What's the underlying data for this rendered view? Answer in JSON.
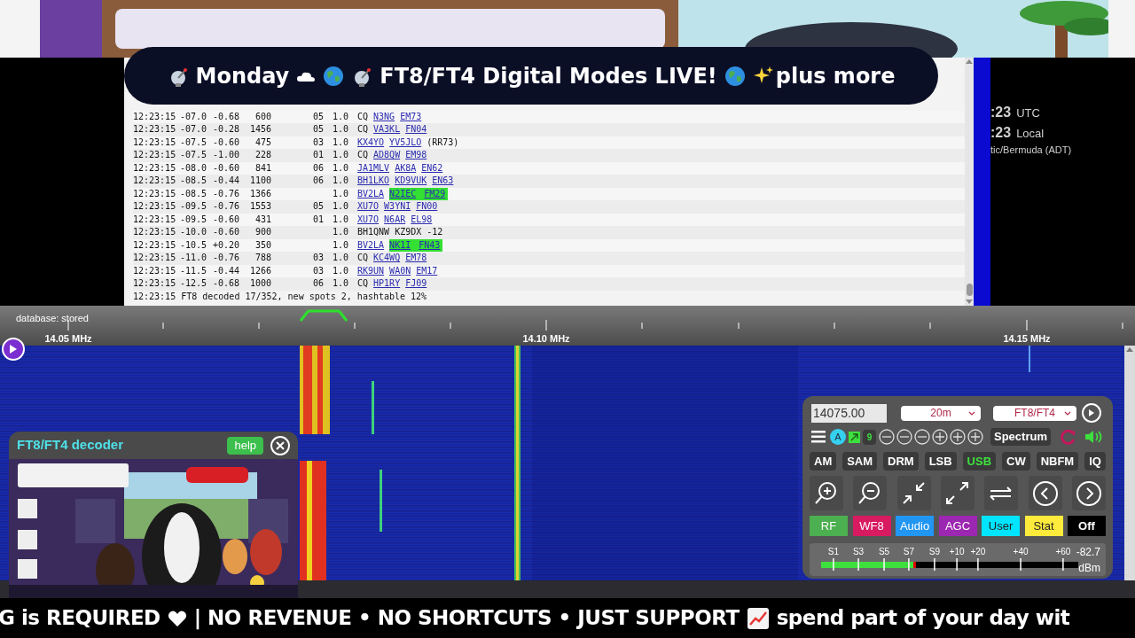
{
  "title_bar": {
    "segments": [
      "Monday",
      "FT8/FT4 Digital Modes LIVE!",
      "plus more"
    ]
  },
  "log": {
    "rows": [
      {
        "time": "12:23:15",
        "snr": "-07.0",
        "dt": "-0.68",
        "freq": "600",
        "slot": "05",
        "ver": "1.0",
        "message": [
          {
            "kind": "text",
            "text": "CQ"
          },
          {
            "kind": "link",
            "text": "N3NG"
          },
          {
            "kind": "link",
            "text": "EM73"
          }
        ]
      },
      {
        "time": "12:23:15",
        "snr": "-07.0",
        "dt": "-0.28",
        "freq": "1456",
        "slot": "05",
        "ver": "1.0",
        "message": [
          {
            "kind": "text",
            "text": "CQ"
          },
          {
            "kind": "link",
            "text": "VA3KL"
          },
          {
            "kind": "link",
            "text": "FN04"
          }
        ]
      },
      {
        "time": "12:23:15",
        "snr": "-07.5",
        "dt": "-0.60",
        "freq": "475",
        "slot": "03",
        "ver": "1.0",
        "message": [
          {
            "kind": "link",
            "text": "KX4YO"
          },
          {
            "kind": "link",
            "text": "YV5JLO"
          },
          {
            "kind": "text",
            "text": "(RR73)"
          }
        ]
      },
      {
        "time": "12:23:15",
        "snr": "-07.5",
        "dt": "-1.00",
        "freq": "228",
        "slot": "01",
        "ver": "1.0",
        "message": [
          {
            "kind": "text",
            "text": "CQ"
          },
          {
            "kind": "link",
            "text": "AD8QW"
          },
          {
            "kind": "link",
            "text": "EM98"
          }
        ]
      },
      {
        "time": "12:23:15",
        "snr": "-08.0",
        "dt": "-0.60",
        "freq": "841",
        "slot": "06",
        "ver": "1.0",
        "message": [
          {
            "kind": "link",
            "text": "JA1MLV"
          },
          {
            "kind": "link",
            "text": "AK8A"
          },
          {
            "kind": "link",
            "text": "EN62"
          }
        ]
      },
      {
        "time": "12:23:15",
        "snr": "-08.5",
        "dt": "-0.44",
        "freq": "1100",
        "slot": "06",
        "ver": "1.0",
        "message": [
          {
            "kind": "link",
            "text": "BH1LKO"
          },
          {
            "kind": "link",
            "text": "KD9VUK"
          },
          {
            "kind": "link",
            "text": "EN63"
          }
        ]
      },
      {
        "time": "12:23:15",
        "snr": "-08.5",
        "dt": "-0.76",
        "freq": "1366",
        "ver": "1.0",
        "message": [
          {
            "kind": "link",
            "text": "BV2LA"
          },
          {
            "kind": "spot",
            "text": "N2IEC"
          },
          {
            "kind": "spot",
            "text": "FM29"
          }
        ]
      },
      {
        "time": "12:23:15",
        "snr": "-09.5",
        "dt": "-0.76",
        "freq": "1553",
        "slot": "05",
        "ver": "1.0",
        "message": [
          {
            "kind": "link",
            "text": "XU7O"
          },
          {
            "kind": "link",
            "text": "W3YNI"
          },
          {
            "kind": "link",
            "text": "FN00"
          }
        ]
      },
      {
        "time": "12:23:15",
        "snr": "-09.5",
        "dt": "-0.60",
        "freq": "431",
        "slot": "01",
        "ver": "1.0",
        "message": [
          {
            "kind": "link",
            "text": "XU7O"
          },
          {
            "kind": "link",
            "text": "N6AR"
          },
          {
            "kind": "link",
            "text": "EL98"
          }
        ]
      },
      {
        "time": "12:23:15",
        "snr": "-10.0",
        "dt": "-0.60",
        "freq": "900",
        "ver": "1.0",
        "message": [
          {
            "kind": "text",
            "text": "BH1QNW"
          },
          {
            "kind": "text",
            "text": "KZ9DX"
          },
          {
            "kind": "text",
            "text": "-12"
          }
        ]
      },
      {
        "time": "12:23:15",
        "snr": "-10.5",
        "dt": "+0.20",
        "freq": "350",
        "ver": "1.0",
        "message": [
          {
            "kind": "link",
            "text": "BV2LA"
          },
          {
            "kind": "spot",
            "text": "NK1I"
          },
          {
            "kind": "spot",
            "text": "FN43"
          }
        ]
      },
      {
        "time": "12:23:15",
        "snr": "-11.0",
        "dt": "-0.76",
        "freq": "788",
        "slot": "03",
        "ver": "1.0",
        "message": [
          {
            "kind": "text",
            "text": "CQ"
          },
          {
            "kind": "link",
            "text": "KC4WQ"
          },
          {
            "kind": "link",
            "text": "EM78"
          }
        ]
      },
      {
        "time": "12:23:15",
        "snr": "-11.5",
        "dt": "-0.44",
        "freq": "1266",
        "slot": "03",
        "ver": "1.0",
        "message": [
          {
            "kind": "link",
            "text": "RK9UN"
          },
          {
            "kind": "link",
            "text": "WA0N"
          },
          {
            "kind": "link",
            "text": "EM17"
          }
        ]
      },
      {
        "time": "12:23:15",
        "snr": "-12.5",
        "dt": "-0.68",
        "freq": "1000",
        "slot": "06",
        "ver": "1.0",
        "message": [
          {
            "kind": "text",
            "text": "CQ"
          },
          {
            "kind": "link",
            "text": "HP1RY"
          },
          {
            "kind": "link",
            "text": "FJ09"
          }
        ]
      }
    ],
    "status": "12:23:15 FT8 decoded 17/352, new spots 2, hashtable 12%"
  },
  "clock": {
    "utc": ":23",
    "utc_label": "UTC",
    "local": ":23",
    "local_label": "Local",
    "zone": "tic/Bermuda (ADT)"
  },
  "scale": {
    "status": "database: stored",
    "labels": [
      "14.05 MHz",
      "14.10 MHz",
      "14.15 MHz"
    ]
  },
  "decoder": {
    "title": "FT8/FT4 decoder",
    "help": "help"
  },
  "controls": {
    "frequency": "14075.00",
    "band": "20m",
    "mode_select": "FT8/FT4",
    "user_badge": "A",
    "count_badge": "9",
    "spectrum": "Spectrum",
    "modes": [
      {
        "label": "AM",
        "selected": false
      },
      {
        "label": "SAM",
        "selected": false
      },
      {
        "label": "DRM",
        "selected": false
      },
      {
        "label": "LSB",
        "selected": false
      },
      {
        "label": "USB",
        "selected": true
      },
      {
        "label": "CW",
        "selected": false
      },
      {
        "label": "NBFM",
        "selected": false
      },
      {
        "label": "IQ",
        "selected": false
      }
    ],
    "panels": [
      {
        "label": "RF",
        "color": "#4caf50"
      },
      {
        "label": "WF8",
        "color": "#d81b60"
      },
      {
        "label": "Audio",
        "color": "#2196f3"
      },
      {
        "label": "AGC",
        "color": "#9c27b0"
      },
      {
        "label": "User",
        "color": "#00e5ff"
      },
      {
        "label": "Stat",
        "color": "#ffeb3b"
      },
      {
        "label": "Off",
        "color": "#000000"
      }
    ],
    "meter": {
      "scale": [
        "S1",
        "S3",
        "S5",
        "S7",
        "S9",
        "+10",
        "+20",
        "+40",
        "+60"
      ],
      "reading": "-82.7",
      "unit": "dBm",
      "level": 0.37
    }
  },
  "ticker": {
    "segments": [
      "G is REQUIRED",
      "| NO REVENUE • NO SHORTCUTS • JUST SUPPORT",
      "spend part of your day wit"
    ]
  }
}
